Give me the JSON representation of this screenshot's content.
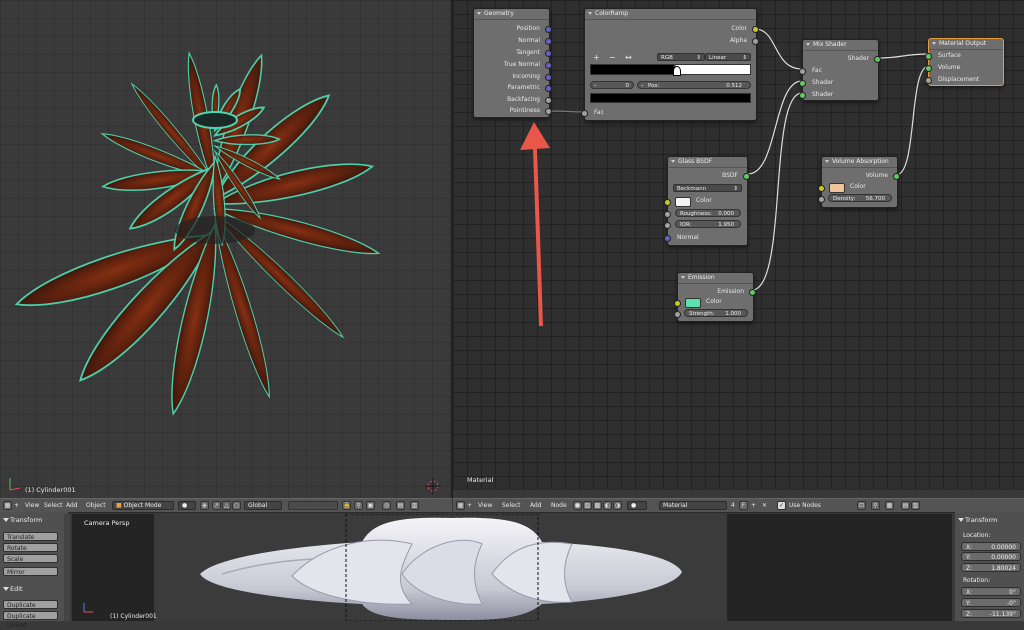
{
  "viewport": {
    "object_label": "(1) Cylinder001"
  },
  "node_editor": {
    "material_label": "Material",
    "geometry": {
      "title": "Geometry",
      "outputs": [
        "Position",
        "Normal",
        "Tangent",
        "True Normal",
        "Incoming",
        "Parametric",
        "Backfacing",
        "Pointiness"
      ]
    },
    "colorramp": {
      "title": "ColorRamp",
      "outputs": [
        "Color",
        "Alpha"
      ],
      "buttons": [
        "+",
        "−",
        "↔"
      ],
      "mode": "RGB",
      "interp": "Linear",
      "index": "0",
      "pos_label": "Pos:",
      "pos_value": "0.512",
      "input": "Fac"
    },
    "mix_shader": {
      "title": "Mix Shader",
      "output": "Shader",
      "inputs": [
        "Fac",
        "Shader",
        "Shader"
      ]
    },
    "material_output": {
      "title": "Material Output",
      "inputs": [
        "Surface",
        "Volume",
        "Displacement"
      ]
    },
    "glass_bsdf": {
      "title": "Glass BSDF",
      "output": "BSDF",
      "distribution": "Beckmann",
      "color_label": "Color",
      "roughness_label": "Roughness:",
      "roughness_value": "0.000",
      "ior_label": "IOR:",
      "ior_value": "1.950",
      "normal_label": "Normal",
      "color_hex": "#f4f4f4"
    },
    "volume_absorption": {
      "title": "Volume Absorption",
      "output": "Volume",
      "color_label": "Color",
      "density_label": "Density:",
      "density_value": "56.700",
      "color_hex": "#f0c49a"
    },
    "emission": {
      "title": "Emission",
      "output": "Emission",
      "color_label": "Color",
      "strength_label": "Strength:",
      "strength_value": "1.000",
      "color_hex": "#5fe0b0"
    }
  },
  "toolbar_3d": {
    "items": [
      "View",
      "Select",
      "Add",
      "Object"
    ],
    "mode": "Object Mode",
    "orientation": "Global"
  },
  "toolbar_node": {
    "items": [
      "View",
      "Select",
      "Add",
      "Node"
    ],
    "material_name": "Material",
    "users": "4",
    "fake": "F",
    "use_nodes": "Use Nodes"
  },
  "toolshelf": {
    "transform_header": "Transform",
    "transform_buttons": [
      "Translate",
      "Rotate",
      "Scale",
      "Mirror"
    ],
    "edit_header": "Edit",
    "edit_buttons": [
      "Duplicate",
      "Duplicate Linked"
    ]
  },
  "camera_view": {
    "label": "Camera Persp",
    "object_label": "(1) Cylinder001"
  },
  "npanel": {
    "header": "Transform",
    "location_label": "Location:",
    "location": [
      {
        "axis": "X:",
        "value": "0.00000"
      },
      {
        "axis": "Y:",
        "value": "0.00000"
      },
      {
        "axis": "Z:",
        "value": "1.80024"
      }
    ],
    "rotation_label": "Rotation:",
    "rotation": [
      {
        "axis": "X:",
        "value": "0°"
      },
      {
        "axis": "Y:",
        "value": "-0°"
      },
      {
        "axis": "Z:",
        "value": "-11.139°"
      }
    ]
  },
  "colors": {
    "selection": "#e89b3a",
    "annotation_arrow": "#e8574a",
    "teal": "#4fd6b0"
  }
}
